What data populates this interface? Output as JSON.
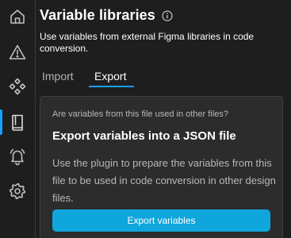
{
  "sidebar": {
    "items": [
      {
        "icon": "home-icon"
      },
      {
        "icon": "warning-icon"
      },
      {
        "icon": "components-icon"
      },
      {
        "icon": "book-icon",
        "active": true
      },
      {
        "icon": "bell-icon"
      },
      {
        "icon": "gear-icon"
      }
    ]
  },
  "header": {
    "title": "Variable libraries",
    "info_icon": "info-icon",
    "subtitle": "Use variables from external Figma libraries in code conversion."
  },
  "tabs": [
    {
      "label": "Import",
      "active": false
    },
    {
      "label": "Export",
      "active": true
    }
  ],
  "export_card": {
    "question": "Are variables from this file used in other files?",
    "heading": "Export variables into a JSON file",
    "body": "Use the plugin to prepare the variables from this file to be used in code conversion in other design files.",
    "button_label": "Export variables"
  },
  "colors": {
    "accent": "#18a0fb",
    "button": "#0fa6dd",
    "background": "#1e1e1e",
    "card": "#2c2c2c"
  }
}
